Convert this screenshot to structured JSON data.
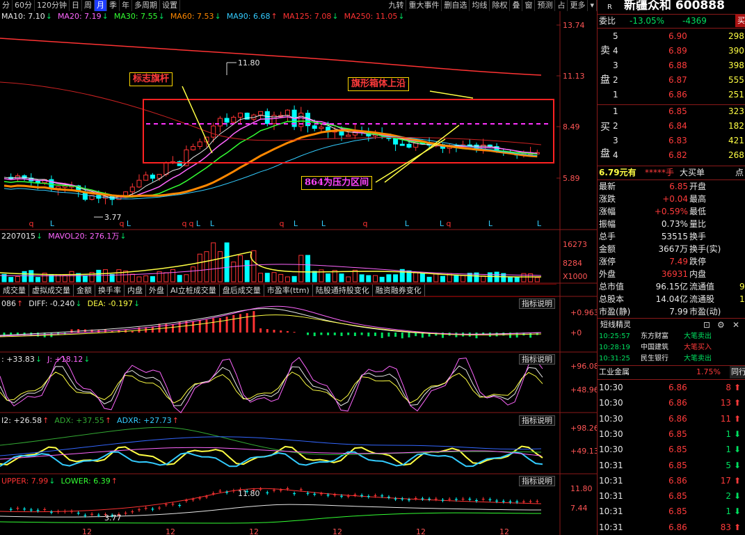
{
  "toolbar": {
    "left_items": [
      "分",
      "60分",
      "120分钟",
      "日",
      "周",
      "月",
      "季",
      "年",
      "多周期",
      "设置"
    ],
    "active": "月",
    "right_items": [
      "九转",
      "重大事件",
      "删自选",
      "均线",
      "除权",
      "叠",
      "窗",
      "预测",
      "占",
      "更多"
    ]
  },
  "ma_legend": [
    {
      "text": "MA10: 7.10",
      "arrow": "↓",
      "color": "#e8e8e8"
    },
    {
      "text": "MA20: 7.19",
      "arrow": "↓",
      "color": "#ff66ff"
    },
    {
      "text": "MA30: 7.55",
      "arrow": "↓",
      "color": "#33ff33"
    },
    {
      "text": "MA60: 7.53",
      "arrow": "↓",
      "color": "#ff8800"
    },
    {
      "text": "MA90: 6.68",
      "arrow": "↑",
      "color": "#33ccff"
    },
    {
      "text": "MA125: 7.08",
      "arrow": "↓",
      "color": "#ff3333"
    },
    {
      "text": "MA250: 11.05",
      "arrow": "↓",
      "color": "#ff3333"
    }
  ],
  "price_axis": [
    "13.74",
    "11.13",
    "8.49",
    "5.89"
  ],
  "price_marks": {
    "high": "11.80",
    "low": "3.77"
  },
  "annotations": {
    "flagpole": "标志旗杆",
    "box_top": "旗形箱体上沿",
    "pressure": "864为压力区间"
  },
  "signal_row": [
    "q",
    "L",
    "q",
    "L",
    "q",
    "q",
    "L",
    "L",
    "q",
    "L",
    "L",
    "q",
    "L",
    "L",
    "q",
    "L",
    "L"
  ],
  "vol_legend": [
    {
      "text": "2207015",
      "arrow": "↓",
      "color": "#e8e8e8"
    },
    {
      "text": "MAVOL20: 276.1万",
      "arrow": "↓",
      "color": "#ff66ff"
    }
  ],
  "vol_axis": [
    "16273",
    "8284",
    "X1000"
  ],
  "indicator_tabs": [
    "成交量",
    "虚拟成交量",
    "金额",
    "换手率",
    "内盘",
    "外盘",
    "AI立桩成交量",
    "盘后成交量",
    "市盈率(ttm)",
    "陆股通持股变化",
    "融资融券变化"
  ],
  "desc_button": "指标说明",
  "macd_legend": [
    {
      "text": "086",
      "arrow": "↑",
      "color": "#e8e8e8"
    },
    {
      "text": "DIFF: -0.240",
      "arrow": "↓",
      "color": "#e8e8e8"
    },
    {
      "text": "DEA: -0.197",
      "arrow": "↓",
      "color": "#ffff44"
    }
  ],
  "macd_axis": [
    "+0.963",
    "+0"
  ],
  "kdj_legend": [
    {
      "text": ": +33.83",
      "arrow": "↓",
      "color": "#e8e8e8"
    },
    {
      "text": "J: +18.12",
      "arrow": "↓",
      "color": "#ff66ff"
    }
  ],
  "kdj_axis": [
    "+96.08",
    "+48.96"
  ],
  "dmi_legend": [
    {
      "text": "I2: +26.58",
      "arrow": "↑",
      "color": "#e8e8e8"
    },
    {
      "text": "ADX: +37.55",
      "arrow": "↑",
      "color": "#33aa33"
    },
    {
      "text": "ADXR: +27.73",
      "arrow": "↑",
      "color": "#33ccff"
    }
  ],
  "dmi_axis": [
    "+98.26",
    "+49.13"
  ],
  "boll_legend": [
    {
      "text": "UPPER: 7.99",
      "arrow": "↓",
      "color": "#ff3333"
    },
    {
      "text": "LOWER: 6.39",
      "arrow": "↑",
      "color": "#33ff33"
    }
  ],
  "boll_axis": [
    "11.80",
    "7.44"
  ],
  "boll_marks": {
    "high": "11.80",
    "low": "3.77"
  },
  "x_ticks": [
    "12",
    "12",
    "12",
    "12",
    "12",
    "12",
    "12"
  ],
  "stock": {
    "r_label": "R",
    "name": "新疆众和",
    "code": "600888"
  },
  "weibi": {
    "label": "委比",
    "pct": "-13.05%",
    "diff": "-4369",
    "btn": "买"
  },
  "sell_label": [
    "卖",
    "盘"
  ],
  "buy_label": [
    "买",
    "盘"
  ],
  "sell_orders": [
    {
      "lvl": "5",
      "price": "6.90",
      "vol": "298"
    },
    {
      "lvl": "4",
      "price": "6.89",
      "vol": "390"
    },
    {
      "lvl": "3",
      "price": "6.88",
      "vol": "398"
    },
    {
      "lvl": "2",
      "price": "6.87",
      "vol": "555"
    },
    {
      "lvl": "1",
      "price": "6.86",
      "vol": "251"
    }
  ],
  "buy_orders": [
    {
      "lvl": "1",
      "price": "6.85",
      "vol": "323"
    },
    {
      "lvl": "2",
      "price": "6.84",
      "vol": "182"
    },
    {
      "lvl": "3",
      "price": "6.83",
      "vol": "421"
    },
    {
      "lvl": "4",
      "price": "6.82",
      "vol": "268"
    }
  ],
  "big_order": {
    "price": "6.79元有",
    "stars": "*****手",
    "label": "大买单",
    "extra": "点"
  },
  "quote_rows": [
    {
      "l": "最新",
      "lv": "6.85",
      "r": "开盘",
      "lc": "red"
    },
    {
      "l": "涨跌",
      "lv": "+0.04",
      "r": "最高",
      "lc": "red"
    },
    {
      "l": "涨幅",
      "lv": "+0.59%",
      "r": "最低",
      "lc": "red"
    },
    {
      "l": "振幅",
      "lv": "0.73%",
      "r": "量比",
      "lc": "white"
    },
    {
      "l": "总手",
      "lv": "53515",
      "r": "换手",
      "lc": "white"
    },
    {
      "l": "金额",
      "lv": "3667万",
      "r": "换手(实)",
      "lc": "white"
    },
    {
      "l": "涨停",
      "lv": "7.49",
      "r": "跌停",
      "lc": "red"
    },
    {
      "l": "外盘",
      "lv": "36931",
      "r": "内盘",
      "lc": "red"
    },
    {
      "l": "总市值",
      "lv": "96.15亿",
      "r": "流通值",
      "lc": "white",
      "extra": "9"
    },
    {
      "l": "总股本",
      "lv": "14.04亿",
      "r": "流通股",
      "lc": "white",
      "extra": "1"
    },
    {
      "l": "市盈(静)",
      "lv": "7.99",
      "r": "市盈(动)",
      "lc": "white"
    }
  ],
  "short_title": "短线精灵",
  "short_items": [
    {
      "time": "10:25:57",
      "name": "东方财富",
      "action": "大笔卖出",
      "ac": "green"
    },
    {
      "time": "10:28:19",
      "name": "中国建筑",
      "action": "大笔买入",
      "ac": "red"
    },
    {
      "time": "10:31:25",
      "name": "民生银行",
      "action": "大笔卖出",
      "ac": "green"
    }
  ],
  "sector": {
    "name": "工业金属",
    "pct": "1.75%",
    "tab": "同行"
  },
  "ticks": [
    {
      "time": "10:30",
      "price": "6.86",
      "vol": "8",
      "dir": "up"
    },
    {
      "time": "10:30",
      "price": "6.86",
      "vol": "13",
      "dir": "up"
    },
    {
      "time": "10:30",
      "price": "6.86",
      "vol": "11",
      "dir": "up"
    },
    {
      "time": "10:30",
      "price": "6.85",
      "vol": "1",
      "dir": "down"
    },
    {
      "time": "10:30",
      "price": "6.85",
      "vol": "1",
      "dir": "down"
    },
    {
      "time": "10:31",
      "price": "6.85",
      "vol": "5",
      "dir": "down"
    },
    {
      "time": "10:31",
      "price": "6.86",
      "vol": "17",
      "dir": "up"
    },
    {
      "time": "10:31",
      "price": "6.85",
      "vol": "2",
      "dir": "down"
    },
    {
      "time": "10:31",
      "price": "6.85",
      "vol": "1",
      "dir": "down"
    },
    {
      "time": "10:31",
      "price": "6.86",
      "vol": "83",
      "dir": "up"
    }
  ]
}
